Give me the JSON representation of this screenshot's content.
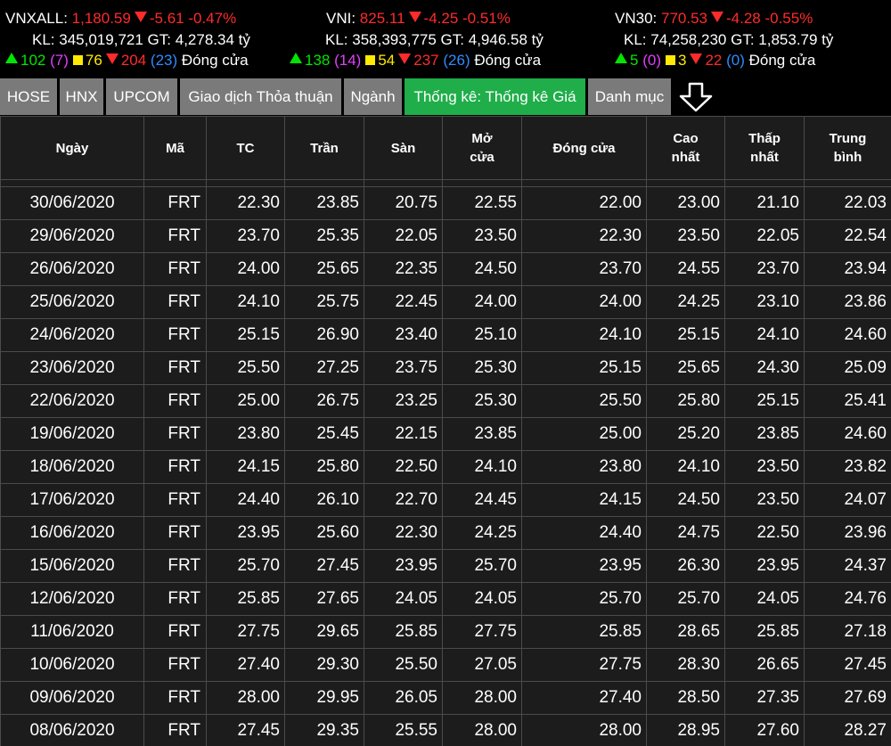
{
  "indices": [
    {
      "name": "VNXALL:",
      "value": "1,180.59",
      "change": "-5.61",
      "change_pct": "-0.47%",
      "volume_label": "KL:",
      "volume": "345,019,721",
      "gt_label": "GT:",
      "gt": "4,278.34 tỷ",
      "up": "102",
      "ceiling": "(7)",
      "unchanged": "76",
      "down": "204",
      "floor": "(23)",
      "status": "Đóng cửa"
    },
    {
      "name": "VNI:",
      "value": "825.11",
      "change": "-4.25",
      "change_pct": "-0.51%",
      "volume_label": "KL:",
      "volume": "358,393,775",
      "gt_label": "GT:",
      "gt": "4,946.58 tỷ",
      "up": "138",
      "ceiling": "(14)",
      "unchanged": "54",
      "down": "237",
      "floor": "(26)",
      "status": "Đóng cửa"
    },
    {
      "name": "VN30:",
      "value": "770.53",
      "change": "-4.28",
      "change_pct": "-0.55%",
      "volume_label": "KL:",
      "volume": "74,258,230",
      "gt_label": "GT:",
      "gt": "1,853.79 tỷ",
      "up": "5",
      "ceiling": "(0)",
      "unchanged": "3",
      "down": "22",
      "floor": "(0)",
      "status": "Đóng cửa"
    }
  ],
  "tabs": [
    {
      "label": "HOSE"
    },
    {
      "label": "HNX"
    },
    {
      "label": "UPCOM"
    },
    {
      "label": "Giao dịch Thỏa thuận"
    },
    {
      "label": "Ngành"
    },
    {
      "label": "Thống kê: Thống kê Giá",
      "active": true
    },
    {
      "label": "Danh mục"
    }
  ],
  "icons": {
    "tab_more": "down-arrow-icon"
  },
  "colors": {
    "active_tab": "#1fae4a",
    "tab": "#7a7a7a",
    "down": "#ff2b2b",
    "up": "#00e600",
    "unchanged": "#ffea00",
    "ceiling": "#e040fb",
    "floor": "#2d8cff"
  },
  "table": {
    "headers": [
      {
        "l1": "Ngày",
        "l2": ""
      },
      {
        "l1": "Mã",
        "l2": ""
      },
      {
        "l1": "TC",
        "l2": ""
      },
      {
        "l1": "Trần",
        "l2": ""
      },
      {
        "l1": "Sàn",
        "l2": ""
      },
      {
        "l1": "Mở",
        "l2": "cửa"
      },
      {
        "l1": "Đóng cửa",
        "l2": ""
      },
      {
        "l1": "Cao",
        "l2": "nhất"
      },
      {
        "l1": "Thấp",
        "l2": "nhất"
      },
      {
        "l1": "Trung",
        "l2": "bình"
      }
    ],
    "rows": [
      [
        "30/06/2020",
        "FRT",
        "22.30",
        "23.85",
        "20.75",
        "22.55",
        "22.00",
        "23.00",
        "21.10",
        "22.03"
      ],
      [
        "29/06/2020",
        "FRT",
        "23.70",
        "25.35",
        "22.05",
        "23.50",
        "22.30",
        "23.50",
        "22.05",
        "22.54"
      ],
      [
        "26/06/2020",
        "FRT",
        "24.00",
        "25.65",
        "22.35",
        "24.50",
        "23.70",
        "24.55",
        "23.70",
        "23.94"
      ],
      [
        "25/06/2020",
        "FRT",
        "24.10",
        "25.75",
        "22.45",
        "24.00",
        "24.00",
        "24.25",
        "23.10",
        "23.86"
      ],
      [
        "24/06/2020",
        "FRT",
        "25.15",
        "26.90",
        "23.40",
        "25.10",
        "24.10",
        "25.15",
        "24.10",
        "24.60"
      ],
      [
        "23/06/2020",
        "FRT",
        "25.50",
        "27.25",
        "23.75",
        "25.30",
        "25.15",
        "25.65",
        "24.30",
        "25.09"
      ],
      [
        "22/06/2020",
        "FRT",
        "25.00",
        "26.75",
        "23.25",
        "25.30",
        "25.50",
        "25.80",
        "25.15",
        "25.41"
      ],
      [
        "19/06/2020",
        "FRT",
        "23.80",
        "25.45",
        "22.15",
        "23.85",
        "25.00",
        "25.20",
        "23.85",
        "24.60"
      ],
      [
        "18/06/2020",
        "FRT",
        "24.15",
        "25.80",
        "22.50",
        "24.10",
        "23.80",
        "24.10",
        "23.50",
        "23.82"
      ],
      [
        "17/06/2020",
        "FRT",
        "24.40",
        "26.10",
        "22.70",
        "24.45",
        "24.15",
        "24.50",
        "23.50",
        "24.07"
      ],
      [
        "16/06/2020",
        "FRT",
        "23.95",
        "25.60",
        "22.30",
        "24.25",
        "24.40",
        "24.75",
        "22.50",
        "23.96"
      ],
      [
        "15/06/2020",
        "FRT",
        "25.70",
        "27.45",
        "23.95",
        "25.70",
        "23.95",
        "26.30",
        "23.95",
        "24.37"
      ],
      [
        "12/06/2020",
        "FRT",
        "25.85",
        "27.65",
        "24.05",
        "24.05",
        "25.70",
        "25.70",
        "24.05",
        "24.76"
      ],
      [
        "11/06/2020",
        "FRT",
        "27.75",
        "29.65",
        "25.85",
        "27.75",
        "25.85",
        "28.65",
        "25.85",
        "27.18"
      ],
      [
        "10/06/2020",
        "FRT",
        "27.40",
        "29.30",
        "25.50",
        "27.05",
        "27.75",
        "28.30",
        "26.65",
        "27.45"
      ],
      [
        "09/06/2020",
        "FRT",
        "28.00",
        "29.95",
        "26.05",
        "28.00",
        "27.40",
        "28.50",
        "27.35",
        "27.69"
      ],
      [
        "08/06/2020",
        "FRT",
        "27.45",
        "29.35",
        "25.55",
        "28.00",
        "28.00",
        "28.95",
        "27.60",
        "28.27"
      ]
    ]
  }
}
